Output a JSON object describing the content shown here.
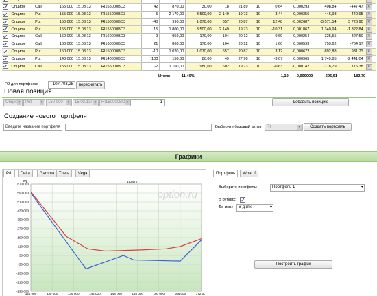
{
  "positions": {
    "rows": [
      {
        "type": "Опцион",
        "cp": "Call",
        "strike": "160 000",
        "date": "15.03.13",
        "code": "RI160000BC3",
        "qty": "-30",
        "price": "2 350,00",
        "v1": "",
        "v2": "",
        "iv": "20,12",
        "days": "10",
        "d1": "-2,29",
        "d2": "-0,000847",
        "d3": "-1 085,17",
        "d4": "-1 651,68",
        "hl": true,
        "partial": true
      },
      {
        "type": "Опцион",
        "cp": "Call",
        "strike": "165 000",
        "date": "15.03.13",
        "code": "RI165000BC3",
        "qty": "42",
        "price": "870,00",
        "v1": "30,00",
        "v2": "18",
        "iv": "21,89",
        "days": "10",
        "d1": "0,64",
        "d2": "0,000293",
        "d3": "408,84",
        "d4": "-447,47",
        "hl": false
      },
      {
        "type": "Опцион",
        "cp": "Put",
        "strike": "155 000",
        "date": "15.03.13",
        "code": "RI155000BO3",
        "qty": "5",
        "price": "2 170,00",
        "v1": "3 500,00",
        "v2": "2 149",
        "iv": "19,73",
        "days": "10",
        "d1": "-3,44",
        "d2": "0,000356",
        "d3": "446,98",
        "d4": "-440,95",
        "hl": true
      },
      {
        "type": "Опцион",
        "cp": "Put",
        "strike": "150 000",
        "date": "15.03.13",
        "code": "RI150000BO3",
        "qty": "-40",
        "price": "990,00",
        "v1": "1 070,00",
        "v2": "657",
        "iv": "20,87",
        "days": "10",
        "d1": "12,48",
        "d2": "-0,002687",
        "d3": "-3 571,54",
        "d4": "3 726,90",
        "hl": true
      },
      {
        "type": "Опцион",
        "cp": "Put",
        "strike": "155 000",
        "date": "15.03.13",
        "code": "RI155000BO3",
        "qty": "15",
        "price": "1 800,00",
        "v1": "3 500,00",
        "v2": "2 149",
        "iv": "19,73",
        "days": "10",
        "d1": "-10,31",
        "d2": "0,001067",
        "d3": "1 340,94",
        "d4": "-1 322,84",
        "hl": true
      },
      {
        "type": "Опцион",
        "cp": "Call",
        "strike": "160 000",
        "date": "15.03.13",
        "code": "RI160000BC3",
        "qty": "9",
        "price": "950,00",
        "v1": "170,00",
        "v2": "104",
        "iv": "20,12",
        "days": "10",
        "d1": "0,69",
        "d2": "0,000254",
        "d3": "325,55",
        "d4": "-327,50",
        "hl": false
      },
      {
        "type": "Опцион",
        "cp": "Call",
        "strike": "160 000",
        "date": "15.03.13",
        "code": "RI160000BC3",
        "qty": "21",
        "price": "860,00",
        "v1": "170,00",
        "v2": "104",
        "iv": "20,12",
        "days": "10",
        "d1": "1,60",
        "d2": "0,000593",
        "d3": "759,62",
        "d4": "-764,17",
        "hl": false
      },
      {
        "type": "Опцион",
        "cp": "Put",
        "strike": "150 000",
        "date": "15.03.13",
        "code": "RI150000BO3",
        "qty": "-10",
        "price": "1 020,00",
        "v1": "1 070,00",
        "v2": "657",
        "iv": "20,87",
        "days": "10",
        "d1": "3,12",
        "d2": "-0,000672",
        "d3": "-892,88",
        "d4": "931,73",
        "hl": true
      },
      {
        "type": "Опцион",
        "cp": "Put",
        "strike": "140 000",
        "date": "15.03.13",
        "code": "RI140000BO3",
        "qty": "100",
        "price": "150,00",
        "v1": "80,00",
        "v2": "49",
        "iv": "27,90",
        "days": "10",
        "d1": "-3,07",
        "d2": "0,000965",
        "d3": "1 749,85",
        "d4": "-2 441,04",
        "hl": false
      },
      {
        "type": "Опцион",
        "cp": "Call",
        "strike": "155 000",
        "date": "15.03.13",
        "code": "RI155000BC3",
        "qty": "-2",
        "price": "1 160,00",
        "v1": "980,00",
        "v2": "602",
        "iv": "19,73",
        "days": "10",
        "d1": "-0,63",
        "d2": "-0,000142",
        "d3": "-178,79",
        "d4": "176,38",
        "hl": true
      }
    ],
    "total_label": "Итого:",
    "total_pct": "11,40%",
    "total_d1": "-1,19",
    "total_d2": "-0,000000",
    "total_d3": "-696,61",
    "total_d4": "182,70"
  },
  "go": {
    "label": "ГО для портфеля:",
    "value": "107 703,28",
    "recalc_label": "пересчитать"
  },
  "new_position": {
    "title": "Новая позиция",
    "type": "Опцион",
    "cp": "Put",
    "strike": "150 000",
    "date": "15.03.13г",
    "code": "RI150000BO3",
    "qty": "1",
    "add_label": "Добавить позицию"
  },
  "new_portfolio": {
    "title": "Создание нового портфеля",
    "name_placeholder": "Введите название портфеля",
    "asset_label": "Выберите базовый актив",
    "asset_value": "RI",
    "create_label": "Создать портфель"
  },
  "charts": {
    "title": "Графики",
    "tabs": [
      "P/L",
      "Delta",
      "Gamma",
      "Theta",
      "Vega"
    ],
    "watermark": "option.ru",
    "y_axis_label": "P/L",
    "marker_label": "152470",
    "right_tabs": [
      "Портфель",
      "What if"
    ],
    "portfolio_label": "Выберите портфель:",
    "portfolio_value": "Портфель 1",
    "rub_label": "В рублях:",
    "expiry_label": "До исп.:",
    "expiry_value": "В днях",
    "build_label": "Построить график"
  },
  "chart_data": {
    "type": "line",
    "y_ticks": [
      670000,
      590000,
      510000,
      430000,
      350000,
      270000,
      190000,
      110000,
      30000,
      -50000,
      -130000,
      -210000,
      -290000
    ],
    "y_tick_labels": [
      "670 000",
      "590 000",
      "510 000",
      "430 000",
      "350 000",
      "270 000",
      "190 000",
      "110 000",
      "30 000",
      "-50 000",
      "-130 000",
      "-210 000",
      "-290 000"
    ],
    "x_ticks": [
      124000,
      130000,
      136000,
      142000,
      148000,
      154000,
      160000,
      166000,
      172000
    ],
    "x_tick_labels": [
      "124 000",
      "130 000",
      "136 000",
      "142 000",
      "148 000",
      "154 000",
      "160 000",
      "166 000",
      "172 000"
    ],
    "ylim": [
      -290000,
      670000
    ],
    "xlim": [
      124000,
      172000
    ],
    "marker_x": 152470,
    "series": [
      {
        "color": "#3a63d8",
        "points": [
          [
            124000,
            590000
          ],
          [
            139500,
            -90000
          ],
          [
            150000,
            30000
          ],
          [
            153000,
            -10000
          ],
          [
            166000,
            -20000
          ],
          [
            172000,
            170000
          ]
        ]
      },
      {
        "color": "#d84040",
        "points": [
          [
            124000,
            600000
          ],
          [
            134000,
            200000
          ],
          [
            140000,
            90000
          ],
          [
            145000,
            70000
          ],
          [
            155000,
            80000
          ],
          [
            162000,
            90000
          ],
          [
            166000,
            110000
          ],
          [
            172000,
            180000
          ]
        ]
      }
    ]
  }
}
